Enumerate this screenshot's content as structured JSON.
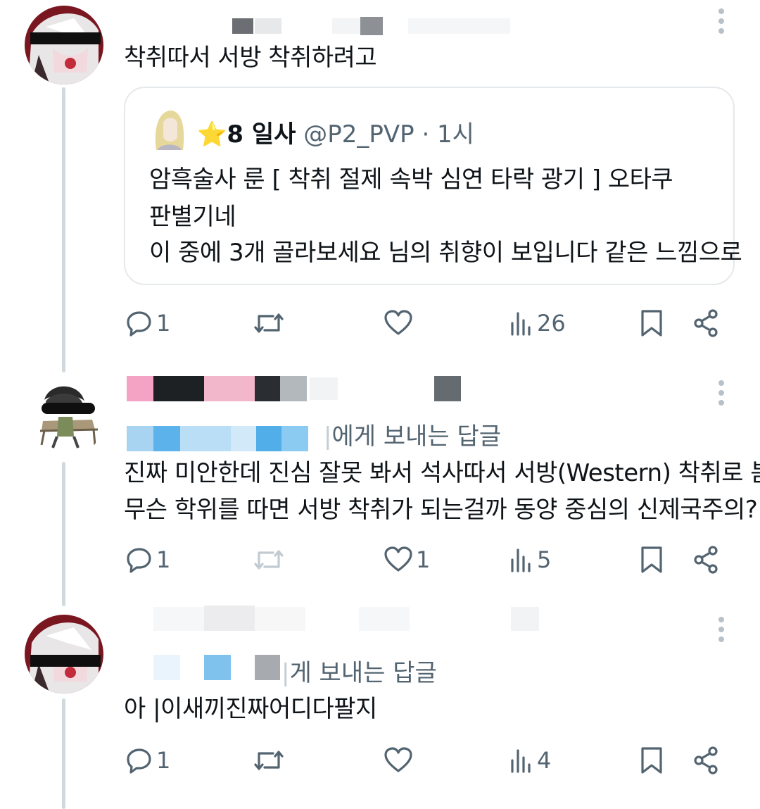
{
  "tweets": [
    {
      "text": "착취따서 서방 착취하려고",
      "quote": {
        "star": "⭐",
        "name": "8 일사",
        "handle": "@P2_PVP",
        "time": "· 1시",
        "lines": [
          "암흑술사 룬 [ 착취 절제 속박 심연 타락 광기 ] 오타쿠",
          "판별기네",
          "이 중에 3개 골라보세요 님의 취향이 보입니다 같은 느낌으로"
        ]
      },
      "actions": {
        "reply": "1",
        "retweet": "",
        "like": "",
        "views": "26"
      }
    },
    {
      "reply_to": "에게 보내는 답글",
      "lines": [
        "진짜 미안한데 진심 잘못 봐서 석사따서 서방(Western) 착취로 봄",
        "무슨 학위를 따면 서방 착취가 되는걸까 동양 중심의 신제국주의?"
      ],
      "actions": {
        "reply": "1",
        "retweet": "",
        "like": "1",
        "views": "5"
      }
    },
    {
      "reply_to": "게 보내는 답글",
      "text": "아 |이새끼진짜어디다팔지",
      "actions": {
        "reply": "1",
        "retweet": "",
        "like": "",
        "views": "4"
      }
    }
  ],
  "icons": {
    "reply": "reply-icon",
    "retweet": "retweet-icon",
    "like": "heart-icon",
    "views": "views-icon",
    "bookmark": "bookmark-icon",
    "share": "share-icon",
    "more": "more-vertical-icon"
  },
  "colors": {
    "text": "#0f1419",
    "secondary": "#536471",
    "thread_line": "#cfd9de",
    "quote_border": "#e5e9ec",
    "star": "#f4b400"
  }
}
